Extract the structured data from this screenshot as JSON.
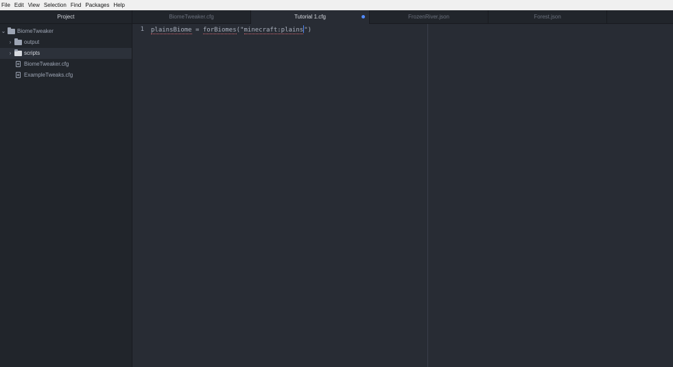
{
  "menubar": {
    "items": [
      "File",
      "Edit",
      "View",
      "Selection",
      "Find",
      "Packages",
      "Help"
    ]
  },
  "sidebar": {
    "title": "Project",
    "tree": [
      {
        "label": "BiomeTweaker",
        "type": "folder",
        "expanded": true,
        "icon": "folder-icon"
      },
      {
        "label": "output",
        "type": "folder",
        "expanded": false,
        "icon": "folder-icon"
      },
      {
        "label": "scripts",
        "type": "folder",
        "expanded": false,
        "selected": true,
        "icon": "folder-icon"
      },
      {
        "label": "BiomeTweaker.cfg",
        "type": "file",
        "icon": "file-text-icon"
      },
      {
        "label": "ExampleTweaks.cfg",
        "type": "file",
        "icon": "file-text-icon"
      }
    ]
  },
  "tabs": [
    {
      "label": "BiomeTweaker.cfg",
      "active": false
    },
    {
      "label": "Tutorial 1.cfg",
      "active": true,
      "modified": true
    },
    {
      "label": "FrozenRiver.json",
      "active": false
    },
    {
      "label": "Forest.json",
      "active": false
    }
  ],
  "editor": {
    "line_number": "1",
    "code": {
      "token1": "plainsBiome",
      "token2": " = ",
      "token3": "forBiomes",
      "token4": "(\"",
      "token5": "minecraft:plains",
      "token6": "\")"
    }
  },
  "colors": {
    "accent": "#528bff",
    "background": "#282c34",
    "sidebar": "#21252b",
    "spellcheck": "#e06c75"
  }
}
